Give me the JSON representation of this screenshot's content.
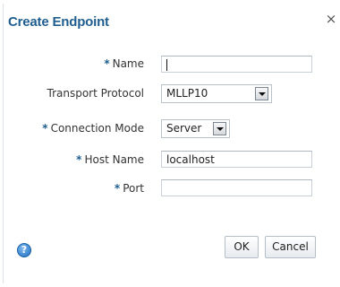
{
  "dialog": {
    "title": "Create Endpoint",
    "close_glyph": "×"
  },
  "form": {
    "required_marker": "*",
    "name": {
      "label": "Name",
      "value": ""
    },
    "transport_protocol": {
      "label": "Transport Protocol",
      "selected": "MLLP10"
    },
    "connection_mode": {
      "label": "Connection Mode",
      "selected": "Server"
    },
    "host_name": {
      "label": "Host Name",
      "value": "localhost"
    },
    "port": {
      "label": "Port",
      "value": ""
    }
  },
  "footer": {
    "help_glyph": "?",
    "ok_label": "OK",
    "cancel_label": "Cancel"
  },
  "colors": {
    "title": "#1f5e8e",
    "required_marker": "#1f5e8e",
    "help_icon": "#1f6fc0"
  },
  "icons": {
    "close": "close-icon",
    "help": "help-icon",
    "dropdown": "chevron-down-icon"
  }
}
